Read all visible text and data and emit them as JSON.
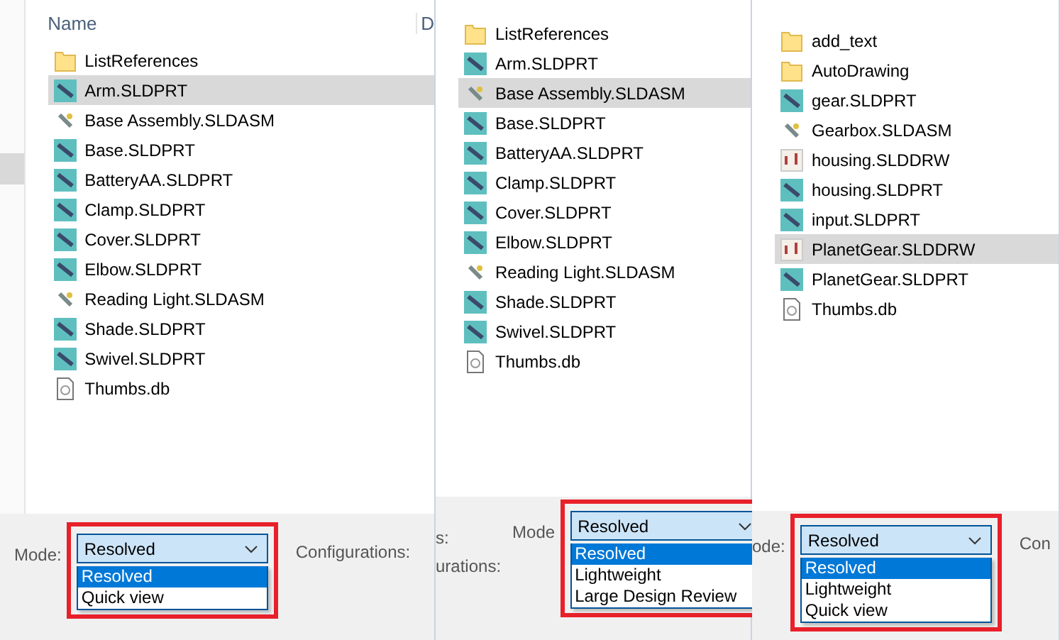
{
  "panels": [
    {
      "header": "Name",
      "header_2": "D",
      "files": [
        {
          "name": "ListReferences",
          "kind": "folder",
          "selected": false
        },
        {
          "name": "Arm.SLDPRT",
          "kind": "part",
          "selected": true
        },
        {
          "name": "Base Assembly.SLDASM",
          "kind": "assembly",
          "selected": false
        },
        {
          "name": "Base.SLDPRT",
          "kind": "part",
          "selected": false
        },
        {
          "name": "BatteryAA.SLDPRT",
          "kind": "part",
          "selected": false
        },
        {
          "name": "Clamp.SLDPRT",
          "kind": "part",
          "selected": false
        },
        {
          "name": "Cover.SLDPRT",
          "kind": "part",
          "selected": false
        },
        {
          "name": "Elbow.SLDPRT",
          "kind": "part",
          "selected": false
        },
        {
          "name": "Reading Light.SLDASM",
          "kind": "assembly",
          "selected": false
        },
        {
          "name": "Shade.SLDPRT",
          "kind": "part",
          "selected": false
        },
        {
          "name": "Swivel.SLDPRT",
          "kind": "part",
          "selected": false
        },
        {
          "name": "Thumbs.db",
          "kind": "db",
          "selected": false
        }
      ],
      "mode_label": "Mode:",
      "combo": {
        "value": "Resolved",
        "options": [
          {
            "label": "Resolved",
            "selected": true
          },
          {
            "label": "Quick view",
            "selected": false
          }
        ]
      },
      "right_label": "Configurations:"
    },
    {
      "files": [
        {
          "name": "ListReferences",
          "kind": "folder",
          "selected": false
        },
        {
          "name": "Arm.SLDPRT",
          "kind": "part",
          "selected": false
        },
        {
          "name": "Base Assembly.SLDASM",
          "kind": "assembly",
          "selected": true
        },
        {
          "name": "Base.SLDPRT",
          "kind": "part",
          "selected": false
        },
        {
          "name": "BatteryAA.SLDPRT",
          "kind": "part",
          "selected": false
        },
        {
          "name": "Clamp.SLDPRT",
          "kind": "part",
          "selected": false
        },
        {
          "name": "Cover.SLDPRT",
          "kind": "part",
          "selected": false
        },
        {
          "name": "Elbow.SLDPRT",
          "kind": "part",
          "selected": false
        },
        {
          "name": "Reading Light.SLDASM",
          "kind": "assembly",
          "selected": false
        },
        {
          "name": "Shade.SLDPRT",
          "kind": "part",
          "selected": false
        },
        {
          "name": "Swivel.SLDPRT",
          "kind": "part",
          "selected": false
        },
        {
          "name": "Thumbs.db",
          "kind": "db",
          "selected": false
        }
      ],
      "side_labels": [
        "s:",
        "urations:"
      ],
      "mode_label": "Mode",
      "combo": {
        "value": "Resolved",
        "options": [
          {
            "label": "Resolved",
            "selected": true
          },
          {
            "label": "Lightweight",
            "selected": false
          },
          {
            "label": "Large Design Review",
            "selected": false
          }
        ]
      }
    },
    {
      "files": [
        {
          "name": "add_text",
          "kind": "folder",
          "selected": false
        },
        {
          "name": "AutoDrawing",
          "kind": "folder",
          "selected": false
        },
        {
          "name": "gear.SLDPRT",
          "kind": "part",
          "selected": false
        },
        {
          "name": "Gearbox.SLDASM",
          "kind": "assembly",
          "selected": false
        },
        {
          "name": "housing.SLDDRW",
          "kind": "drawing",
          "selected": false
        },
        {
          "name": "housing.SLDPRT",
          "kind": "part",
          "selected": false
        },
        {
          "name": "input.SLDPRT",
          "kind": "part",
          "selected": false
        },
        {
          "name": "PlanetGear.SLDDRW",
          "kind": "drawing",
          "selected": true
        },
        {
          "name": "PlanetGear.SLDPRT",
          "kind": "part",
          "selected": false
        },
        {
          "name": "Thumbs.db",
          "kind": "db",
          "selected": false
        }
      ],
      "mode_label": "ode:",
      "combo": {
        "value": "Resolved",
        "options": [
          {
            "label": "Resolved",
            "selected": true
          },
          {
            "label": "Lightweight",
            "selected": false
          },
          {
            "label": "Quick view",
            "selected": false
          }
        ]
      },
      "right_label": "Con"
    }
  ]
}
